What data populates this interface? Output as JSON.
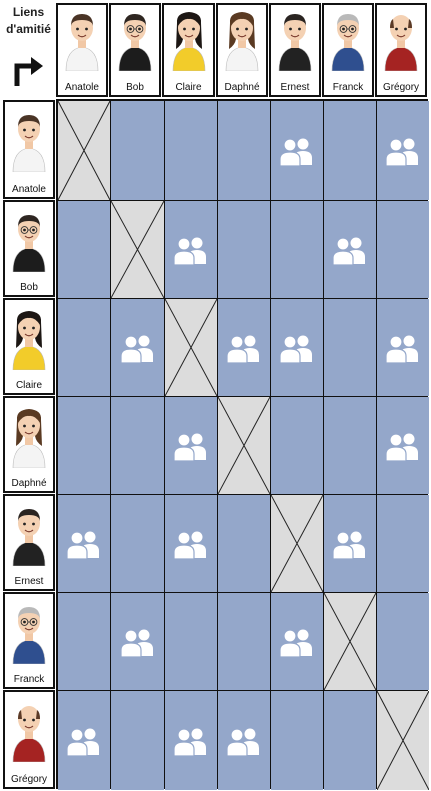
{
  "title_line1": "Liens",
  "title_line2": "d'amitié",
  "colors": {
    "cell": "#94a7ca",
    "diagonal": "#dcdcdc",
    "friend_icon": "#ffffff",
    "grid_line": "#111111"
  },
  "people": [
    {
      "name": "Anatole",
      "hair": "#4a3426",
      "shirt": "#f4f4f4",
      "glasses": false,
      "bald": false,
      "long_hair": false
    },
    {
      "name": "Bob",
      "hair": "#2e2621",
      "shirt": "#1c1c1c",
      "glasses": true,
      "bald": false,
      "long_hair": false
    },
    {
      "name": "Claire",
      "hair": "#1d1714",
      "shirt": "#f2cc2a",
      "glasses": false,
      "bald": false,
      "long_hair": true
    },
    {
      "name": "Daphné",
      "hair": "#5a3a22",
      "shirt": "#f4f4f4",
      "glasses": false,
      "bald": false,
      "long_hair": true
    },
    {
      "name": "Ernest",
      "hair": "#2a2421",
      "shirt": "#222222",
      "glasses": false,
      "bald": false,
      "long_hair": false
    },
    {
      "name": "Franck",
      "hair": "#b9b9b9",
      "shirt": "#2f4f8f",
      "glasses": true,
      "bald": false,
      "long_hair": false
    },
    {
      "name": "Grégory",
      "hair": "#5b3a26",
      "shirt": "#a52322",
      "glasses": false,
      "bald": true,
      "long_hair": false
    }
  ],
  "friendships": [
    [
      0,
      0,
      0,
      0,
      1,
      0,
      1
    ],
    [
      0,
      0,
      1,
      0,
      0,
      1,
      0
    ],
    [
      0,
      1,
      0,
      1,
      1,
      0,
      1
    ],
    [
      0,
      0,
      1,
      0,
      0,
      0,
      1
    ],
    [
      1,
      0,
      1,
      0,
      0,
      1,
      0
    ],
    [
      0,
      1,
      0,
      0,
      1,
      0,
      0
    ],
    [
      1,
      0,
      1,
      1,
      0,
      0,
      0
    ]
  ]
}
